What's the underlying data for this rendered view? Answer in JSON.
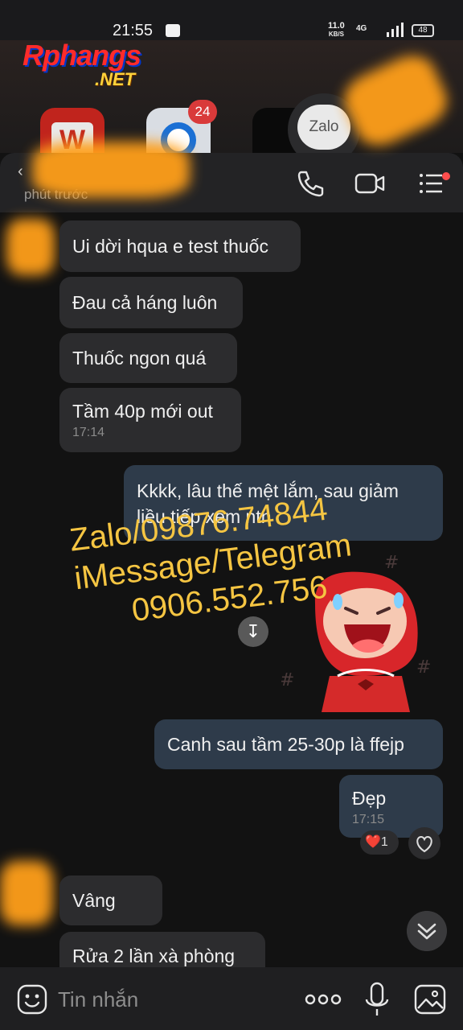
{
  "status_bar": {
    "time": "21:55",
    "net_speed": "11.0",
    "net_speed_unit": "KB/S",
    "network": "4G",
    "battery": "48"
  },
  "watermark": {
    "logo_text": "Rphangs",
    "logo_suffix": ".NET"
  },
  "home": {
    "badge_count": "24",
    "zalo_label": "Zalo"
  },
  "chat_header": {
    "last_seen": "phút trước"
  },
  "messages": [
    {
      "text": "Ui dời hqua e test thuốc",
      "direction": "incoming"
    },
    {
      "text": "Đau cả háng luôn",
      "direction": "incoming"
    },
    {
      "text": "Thuốc ngon quá",
      "direction": "incoming"
    },
    {
      "text": "Tầm 40p mới out",
      "time": "17:14",
      "direction": "incoming"
    },
    {
      "text": "Kkkk, lâu thế mệt lắm, sau giảm liều tiếp xem ntn",
      "direction": "outgoing"
    },
    {
      "text": "Canh sau tầm 25-30p là ffejp",
      "direction": "outgoing"
    },
    {
      "text": "Đẹp",
      "time": "17:15",
      "direction": "outgoing"
    },
    {
      "text": "Vâng",
      "direction": "incoming"
    },
    {
      "text": "Rửa 2 lần xà phòng",
      "direction": "incoming"
    }
  ],
  "reaction": {
    "emoji": "❤️",
    "count": "1"
  },
  "overlay_contact": {
    "line1": "Zalo/09876.74844",
    "line2": "iMessage/Telegram",
    "line3": "0906.552.756"
  },
  "input": {
    "placeholder": "Tin nhắn"
  },
  "colors": {
    "background": "#121212",
    "incoming_bubble": "#2c2c2e",
    "outgoing_bubble": "#2e3b4a",
    "overlay_text": "#f5c542"
  }
}
